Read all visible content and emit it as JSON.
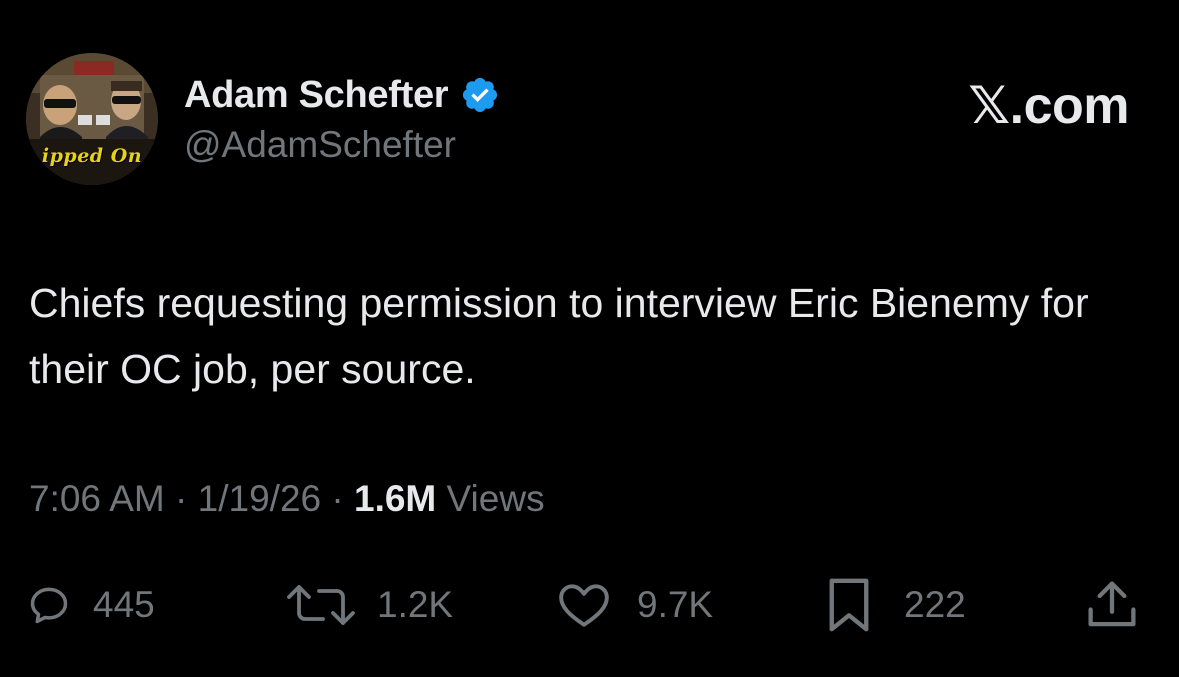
{
  "author": {
    "display_name": "Adam Schefter",
    "handle": "@AdamSchefter",
    "verified": true,
    "verified_color": "#1d9bf0",
    "avatar_caption": "ipped On"
  },
  "brand": "𝕏.com",
  "tweet": {
    "text": "Chiefs requesting permission to interview Eric Bienemy for their OC job, per source."
  },
  "meta": {
    "time": "7:06 AM",
    "separator": " · ",
    "date": "1/19/26",
    "views_count": "1.6M",
    "views_label": " Views"
  },
  "actions": {
    "reply": {
      "icon": "reply-icon",
      "count": "445"
    },
    "repost": {
      "icon": "repost-icon",
      "count": "1.2K"
    },
    "like": {
      "icon": "heart-icon",
      "count": "9.7K"
    },
    "bookmark": {
      "icon": "bookmark-icon",
      "count": "222"
    },
    "share": {
      "icon": "share-icon"
    }
  },
  "colors": {
    "background": "#000000",
    "primary_text": "#e7e9ea",
    "secondary_text": "#71767b"
  }
}
